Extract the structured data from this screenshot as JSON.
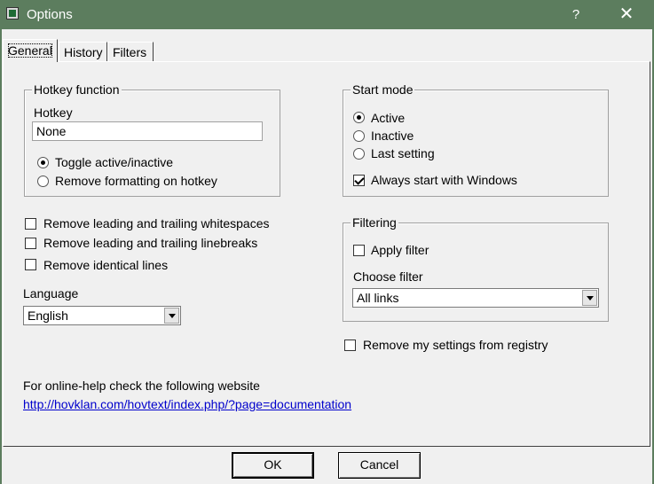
{
  "window": {
    "title": "Options",
    "help_label": "?",
    "close_label": "✕"
  },
  "tabs": [
    "General",
    "History",
    "Filters"
  ],
  "hotkey_group": {
    "title": "Hotkey function",
    "field_label": "Hotkey",
    "field_value": "None",
    "options": [
      "Toggle active/inactive",
      "Remove formatting on hotkey"
    ],
    "selected": "Toggle active/inactive"
  },
  "checkboxes": [
    {
      "label": "Remove leading and trailing whitespaces",
      "checked": false
    },
    {
      "label": "Remove leading and trailing linebreaks",
      "checked": false
    },
    {
      "label": "Remove identical lines",
      "checked": false
    }
  ],
  "language": {
    "label": "Language",
    "value": "English"
  },
  "start_mode": {
    "title": "Start mode",
    "options": [
      "Active",
      "Inactive",
      "Last setting"
    ],
    "selected": "Active",
    "always_start": {
      "label": "Always start with Windows",
      "checked": true
    }
  },
  "filtering": {
    "title": "Filtering",
    "apply": {
      "label": "Apply filter",
      "checked": false
    },
    "choose_label": "Choose filter",
    "choose_value": "All links"
  },
  "remove_settings": {
    "label": "Remove my settings from registry",
    "checked": false
  },
  "help": {
    "text": "For online-help check the following website",
    "link": "http://hovklan.com/hovtext/index.php/?page=documentation"
  },
  "buttons": {
    "ok": "OK",
    "cancel": "Cancel"
  },
  "colors": {
    "titlebar": "#5c7d5e",
    "link": "#0000cc"
  }
}
